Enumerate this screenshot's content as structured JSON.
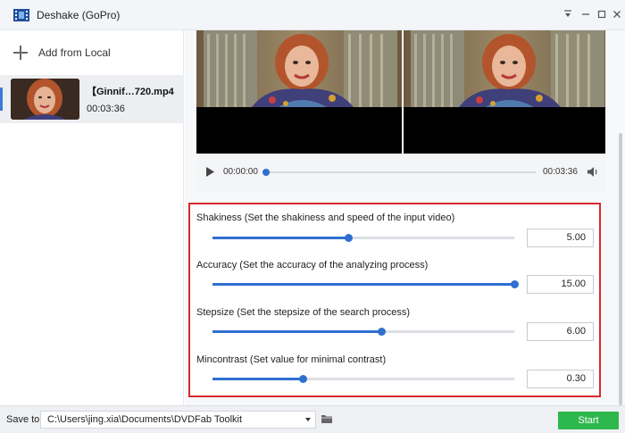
{
  "titlebar": {
    "title": "Deshake (GoPro)",
    "icon": "film-icon"
  },
  "sidebar": {
    "add_label": "Add from Local",
    "files": [
      {
        "name": "【Ginnif…720.mp4",
        "duration": "00:03:36"
      }
    ]
  },
  "player": {
    "current_time": "00:00:00",
    "total_time": "00:03:36",
    "progress": 0
  },
  "params": [
    {
      "label": "Shakiness (Set the shakiness and speed of the input video)",
      "value": "5.00",
      "fraction": 0.45
    },
    {
      "label": "Accuracy (Set the accuracy of the analyzing process)",
      "value": "15.00",
      "fraction": 1.0
    },
    {
      "label": "Stepsize (Set the stepsize of the search process)",
      "value": "6.00",
      "fraction": 0.56
    },
    {
      "label": "Mincontrast (Set value for minimal contrast)",
      "value": "0.30",
      "fraction": 0.3
    }
  ],
  "footer": {
    "save_label": "Save to:",
    "path": "C:\\Users\\jing.xia\\Documents\\DVDFab Toolkit",
    "start_label": "Start"
  },
  "colors": {
    "accent": "#2f6fd0",
    "start": "#2db84d",
    "highlight_border": "#d8292f"
  }
}
